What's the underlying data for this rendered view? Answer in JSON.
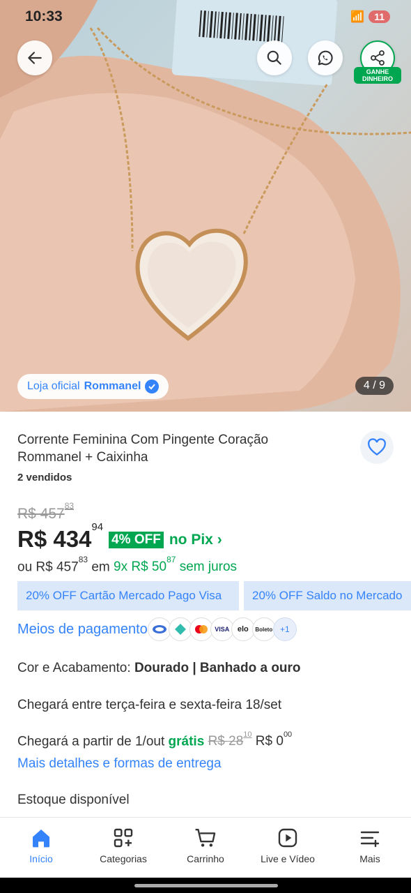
{
  "status_bar": {
    "time": "10:33",
    "battery": "11"
  },
  "hero": {
    "ganhe_label": "GANHE DINHEIRO",
    "store_prefix": "Loja oficial",
    "store_name": "Rommanel",
    "image_counter": "4 / 9"
  },
  "product": {
    "title": "Corrente Feminina Com Pingente Coração Rommanel + Caixinha",
    "sold": "2 vendidos",
    "old_price_int": "R$ 457",
    "old_price_cents": "83",
    "price_int": "R$ 434",
    "price_cents": "94",
    "discount_badge": "4% OFF",
    "pix_label": "no Pix",
    "install_prefix": "ou R$ 457",
    "install_prefix_cents": "83",
    "install_em": "em",
    "install_green": "9x R$ 50",
    "install_green_cents": "87",
    "install_suffix": "sem juros",
    "promo1": "20% OFF Cartão Mercado Pago Visa",
    "promo2": "20% OFF Saldo no Mercado",
    "payment_link": "Meios de pagamento",
    "payment_icons": [
      "pix-icon",
      "boleto-icon",
      "mastercard-icon",
      "visa-icon",
      "elo-icon",
      "barcode-icon"
    ],
    "payment_labels": {
      "visa": "VISA",
      "elo": "elo",
      "boleto": "Boleto"
    },
    "payment_more": "+1",
    "color_label": "Cor e Acabamento:",
    "color_value": "Dourado | Banhado a ouro",
    "arrival1": "Chegará entre terça-feira e sexta-feira 18/set",
    "arrival2_prefix": "Chegará a partir de 1/out",
    "arrival2_free": "grátis",
    "arrival2_old": "R$ 28",
    "arrival2_old_cents": "10",
    "arrival2_new": "R$ 0",
    "arrival2_new_cents": "00",
    "more_link": "Mais detalhes e formas de entrega",
    "stock": "Estoque disponível"
  },
  "tabs": [
    {
      "label": "Início",
      "icon": "home-icon"
    },
    {
      "label": "Categorias",
      "icon": "categories-icon"
    },
    {
      "label": "Carrinho",
      "icon": "cart-icon"
    },
    {
      "label": "Live e Vídeo",
      "icon": "play-icon"
    },
    {
      "label": "Mais",
      "icon": "menu-icon"
    }
  ],
  "colors": {
    "accent": "#3483fa",
    "green": "#00a650"
  }
}
